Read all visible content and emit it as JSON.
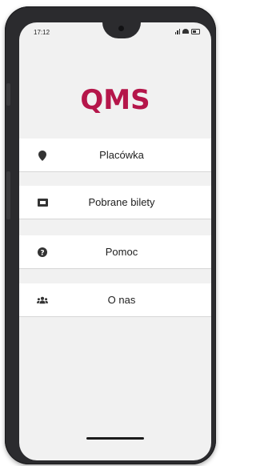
{
  "status_bar": {
    "time": "17:12",
    "icons": [
      "signal-icon",
      "wifi-icon",
      "battery-icon"
    ]
  },
  "app": {
    "logo": "QMS",
    "brand_color": "#b5164a"
  },
  "menu": {
    "items": [
      {
        "label": "Placówka",
        "icon": "location-pin-icon"
      },
      {
        "label": "Pobrane bilety",
        "icon": "ticket-icon"
      },
      {
        "label": "Pomoc",
        "icon": "help-icon"
      },
      {
        "label": "O nas",
        "icon": "users-icon"
      }
    ]
  }
}
